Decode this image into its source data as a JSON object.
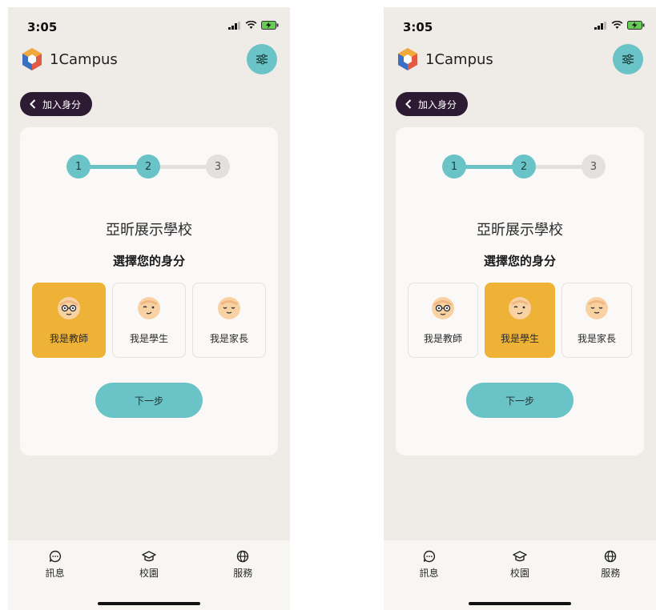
{
  "screens": [
    {
      "status": {
        "time": "3:05"
      },
      "app": {
        "name": "1Campus"
      },
      "back_label": "加入身分",
      "steps": [
        "1",
        "2",
        "3"
      ],
      "current_step": 2,
      "school_name": "亞昕展示學校",
      "prompt": "選擇您的身分",
      "roles": [
        "我是教師",
        "我是學生",
        "我是家長"
      ],
      "selected_role": "我是教師",
      "next_label": "下一步",
      "nav": [
        "訊息",
        "校園",
        "服務"
      ]
    },
    {
      "status": {
        "time": "3:05"
      },
      "app": {
        "name": "1Campus"
      },
      "back_label": "加入身分",
      "steps": [
        "1",
        "2",
        "3"
      ],
      "current_step": 2,
      "school_name": "亞昕展示學校",
      "prompt": "選擇您的身分",
      "roles": [
        "我是教師",
        "我是學生",
        "我是家長"
      ],
      "selected_role": "我是學生",
      "next_label": "下一步",
      "nav": [
        "訊息",
        "校園",
        "服務"
      ]
    }
  ],
  "colors": {
    "accent": "#6ac3c6",
    "selected": "#eeb236",
    "back_button": "#2d1b33",
    "background": "#efebe7",
    "card": "#fbf9f7"
  },
  "icons": {
    "logo": "cube-logo-icon",
    "filter": "sliders-icon",
    "back": "chevron-left-icon",
    "nav": [
      "chat-bubble-icon",
      "graduation-cap-icon",
      "globe-icon"
    ],
    "status": [
      "cellular-signal-icon",
      "wifi-icon",
      "battery-charging-icon"
    ]
  }
}
